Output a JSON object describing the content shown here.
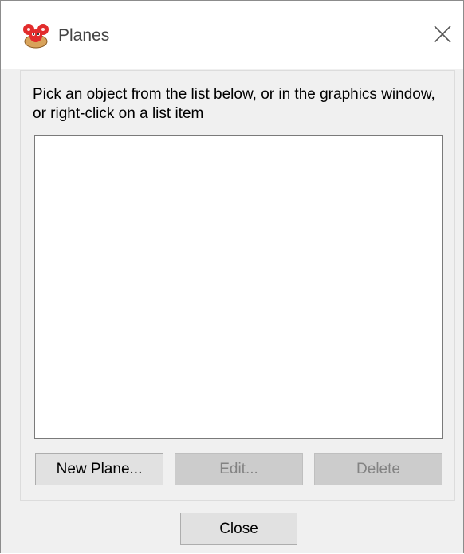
{
  "window": {
    "title": "Planes",
    "app_icon": "app-logo-icon",
    "close_icon": "close-icon"
  },
  "main": {
    "instruction": "Pick an object from the list below, or in the graphics window, or right-click on a list item",
    "list_items": []
  },
  "buttons": {
    "new_plane": "New Plane...",
    "edit": "Edit...",
    "delete": "Delete",
    "close": "Close"
  },
  "states": {
    "new_plane_enabled": true,
    "edit_enabled": false,
    "delete_enabled": false,
    "close_enabled": true
  },
  "colors": {
    "window_bg": "#f0f0f0",
    "titlebar_bg": "#ffffff",
    "button_bg": "#e1e1e1",
    "button_disabled_bg": "#cccccc",
    "disabled_text": "#838383"
  }
}
